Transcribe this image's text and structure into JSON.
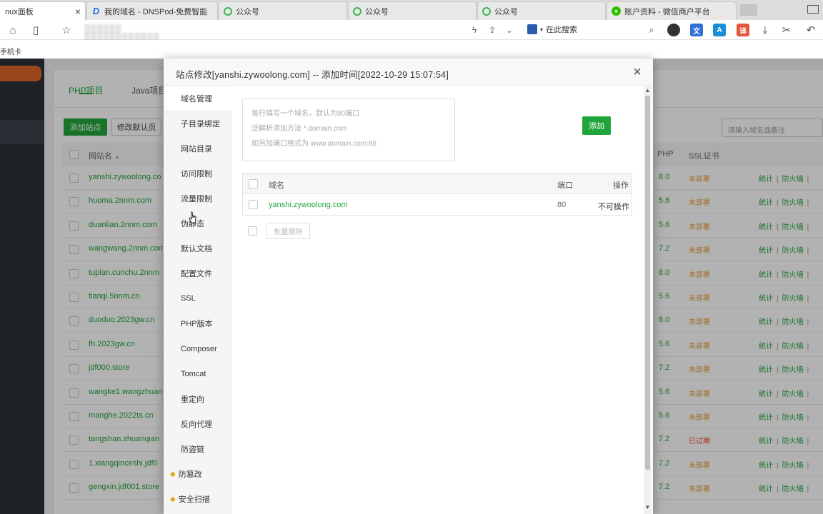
{
  "browser": {
    "tabs": [
      {
        "title": "nux面板",
        "icon": "",
        "active": true
      },
      {
        "title": "我的域名 - DNSPod-免费智能",
        "icon": "dnspod-icon"
      },
      {
        "title": "公众号",
        "icon": "wechat-mp-icon"
      },
      {
        "title": "公众号",
        "icon": "wechat-mp-icon"
      },
      {
        "title": "公众号",
        "icon": "wechat-mp-icon"
      },
      {
        "title": "账户资料 - 微信商户平台",
        "icon": "wechat-pay-icon"
      }
    ],
    "tab_close": "×",
    "search_engine": "在此搜索",
    "bookmark": "手机卡"
  },
  "panel": {
    "tabs": [
      "PHP项目",
      "Java项目"
    ],
    "add_site": "添加站点",
    "edit_default": "修改默认页",
    "search_placeholder": "请输入域名或备注",
    "columns": {
      "name": "网站名",
      "php": "PHP",
      "ssl": "SSL证书"
    },
    "action_stats": "统计",
    "action_firewall": "防火墙",
    "action_sep": "|",
    "rows": [
      {
        "name": "yanshi.zywoolong.co",
        "php": "8.0",
        "ssl": "未部署",
        "ssl_color": "#e6a23c"
      },
      {
        "name": "huoma.2nnm.com",
        "php": "5.6",
        "ssl": "未部署",
        "ssl_color": "#e6a23c"
      },
      {
        "name": "duanlian.2nnm.com",
        "php": "5.6",
        "ssl": "未部署",
        "ssl_color": "#e6a23c"
      },
      {
        "name": "wangwang.2nnm.com",
        "php": "7.2",
        "ssl": "未部署",
        "ssl_color": "#e6a23c"
      },
      {
        "name": "tupian.cunchu.2nnm",
        "php": "8.0",
        "ssl": "未部署",
        "ssl_color": "#e6a23c"
      },
      {
        "name": "tianqi.5nnm.cn",
        "php": "5.6",
        "ssl": "未部署",
        "ssl_color": "#e6a23c"
      },
      {
        "name": "duoduo.2023gw.cn",
        "php": "8.0",
        "ssl": "未部署",
        "ssl_color": "#e6a23c"
      },
      {
        "name": "fh.2023gw.cn",
        "php": "5.6",
        "ssl": "未部署",
        "ssl_color": "#e6a23c"
      },
      {
        "name": "jdf000.store",
        "php": "7.2",
        "ssl": "未部署",
        "ssl_color": "#e6a23c"
      },
      {
        "name": "wangke1.wangzhuan",
        "php": "5.6",
        "ssl": "未部署",
        "ssl_color": "#e6a23c"
      },
      {
        "name": "manghe.2022ts.cn",
        "php": "5.6",
        "ssl": "未部署",
        "ssl_color": "#e6a23c"
      },
      {
        "name": "tangshan.zhuanqian",
        "php": "7.2",
        "ssl": "已过期",
        "ssl_color": "#e8473a"
      },
      {
        "name": "1.xiangqinceshi.jdf0",
        "php": "7.2",
        "ssl": "未部署",
        "ssl_color": "#e6a23c"
      },
      {
        "name": "gengxin.jdf001.store",
        "php": "7.2",
        "ssl": "未部署",
        "ssl_color": "#e6a23c"
      }
    ]
  },
  "modal": {
    "title": "站点修改[yanshi.zywoolong.com] -- 添加时间[2022-10-29 15:07:54]",
    "close": "×",
    "nav": [
      {
        "label": "域名管理",
        "active": true
      },
      {
        "label": "子目录绑定"
      },
      {
        "label": "网站目录"
      },
      {
        "label": "访问限制"
      },
      {
        "label": "流量限制"
      },
      {
        "label": "伪静态"
      },
      {
        "label": "默认文档"
      },
      {
        "label": "配置文件"
      },
      {
        "label": "SSL"
      },
      {
        "label": "PHP版本"
      },
      {
        "label": "Composer"
      },
      {
        "label": "Tomcat"
      },
      {
        "label": "重定向"
      },
      {
        "label": "反向代理"
      },
      {
        "label": "防盗链"
      },
      {
        "label": "防篡改",
        "pro": true
      },
      {
        "label": "安全扫描",
        "pro": true
      }
    ],
    "placeholder_lines": [
      "每行填写一个域名，默认为80端口",
      "泛解析添加方法 *.domain.com",
      "如另加端口格式为 www.domain.com:88"
    ],
    "add_button": "添加",
    "table_headers": {
      "domain": "域名",
      "port": "端口",
      "action": "操作"
    },
    "domains": [
      {
        "domain": "yanshi.zywoolong.com",
        "port": "80",
        "action": "不可操作"
      }
    ],
    "bulk_delete": "批量删除"
  }
}
